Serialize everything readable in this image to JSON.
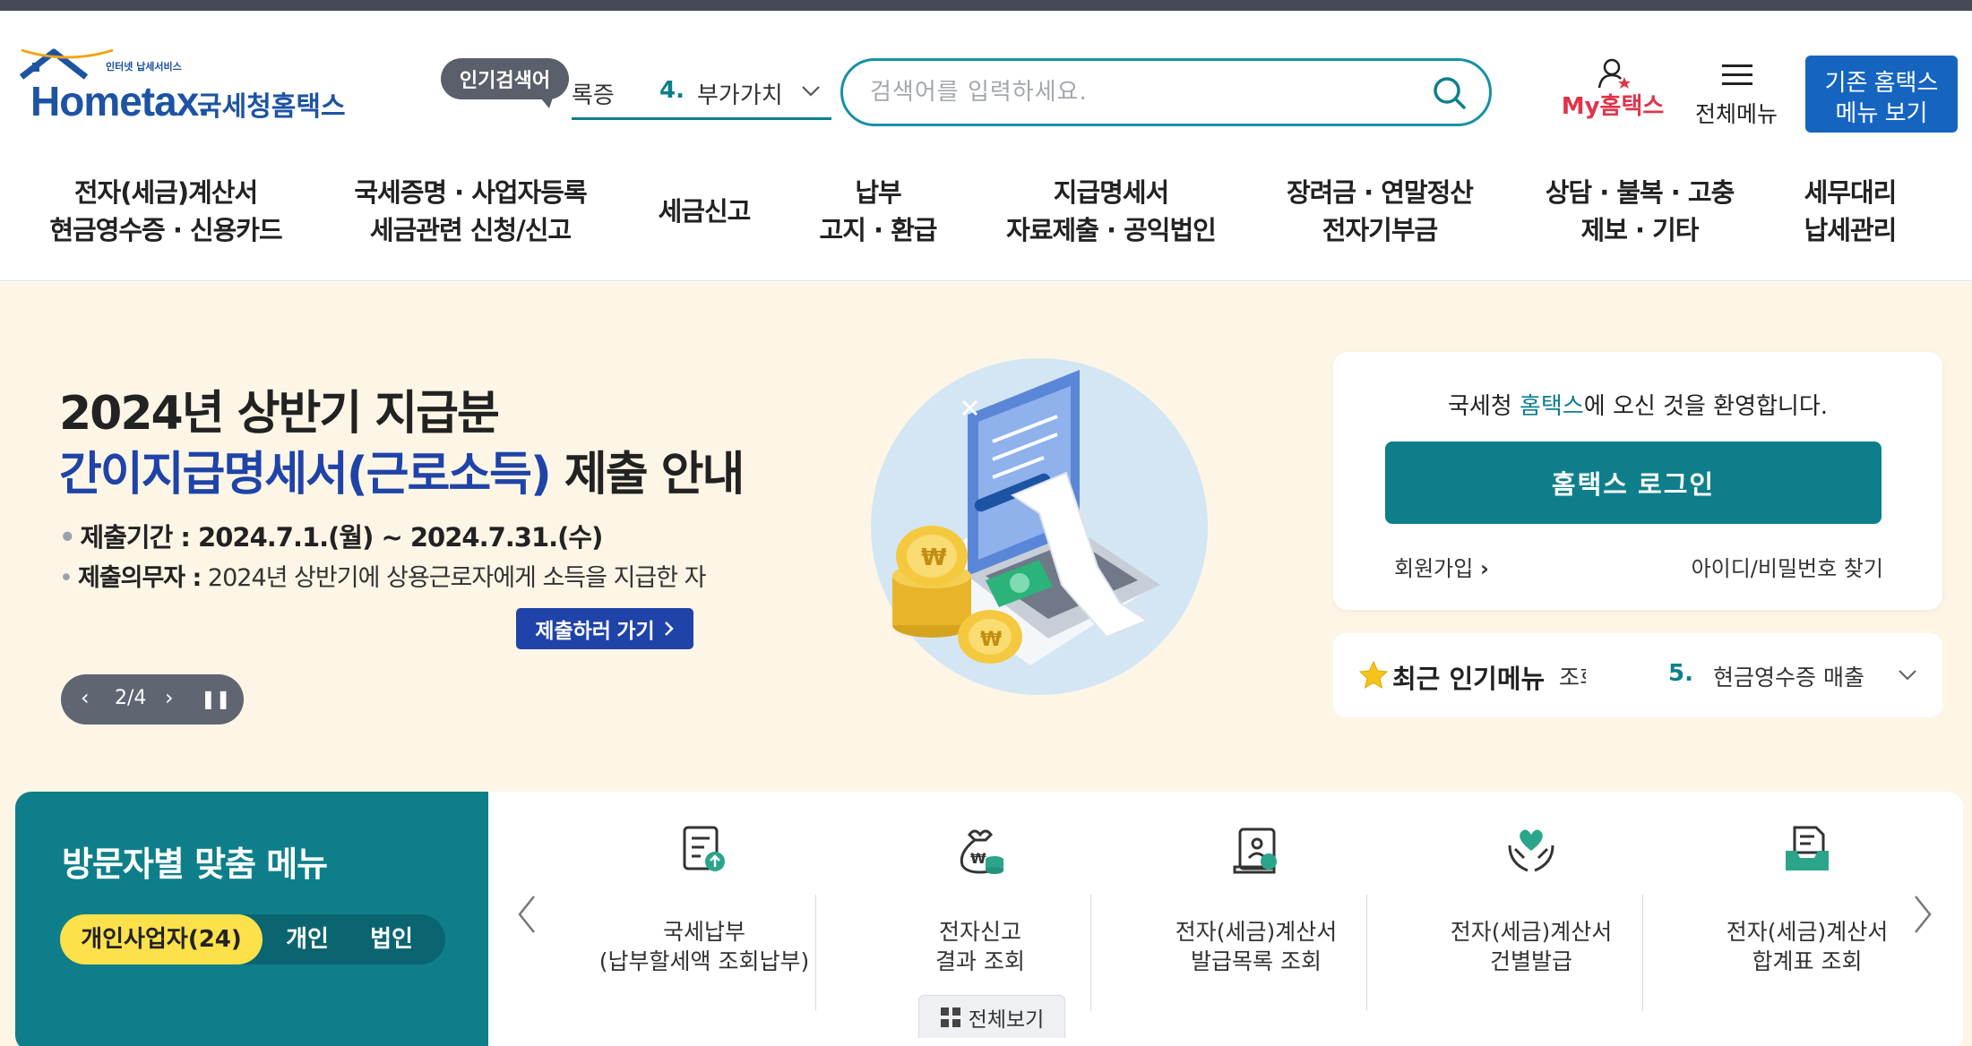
{
  "logo": {
    "sub": "인터넷 납세서비스",
    "main": "Hometax.",
    "kr": "국세청홈택스"
  },
  "search": {
    "popular_tag": "인기검색어",
    "rank_prev": "록증",
    "rank_num": "4.",
    "rank_text": "부가가치",
    "placeholder": "검색어를 입력하세요."
  },
  "header_actions": {
    "my_hometax": "My홈택스",
    "all_menu": "전체메뉴",
    "classic_line1": "기존 홈택스",
    "classic_line2": "메뉴 보기"
  },
  "gnb": [
    {
      "line1": "전자(세금)계산서",
      "line2": "현금영수증 · 신용카드"
    },
    {
      "line1": "국세증명 · 사업자등록",
      "line2": "세금관련 신청/신고"
    },
    {
      "line1": "세금신고",
      "line2": ""
    },
    {
      "line1": "납부",
      "line2": "고지 · 환급"
    },
    {
      "line1": "지급명세서",
      "line2": "자료제출 · 공익법인"
    },
    {
      "line1": "장려금 · 연말정산",
      "line2": "전자기부금"
    },
    {
      "line1": "상담 · 불복 · 고충",
      "line2": "제보 · 기타"
    },
    {
      "line1": "세무대리",
      "line2": "납세관리"
    }
  ],
  "hero": {
    "title1": "2024년 상반기 지급분",
    "title2_blue": "간이지급명세서(근로소득)",
    "title2_rest": " 제출 안내",
    "bullet1": "제출기간 : 2024.7.1.(월) ~ 2024.7.31.(수)",
    "bullet2_label": "제출의무자 :",
    "bullet2_text": " 2024년 상반기에 상용근로자에게 소득을 지급한 자",
    "cta": "제출하러 가기",
    "slide_indicator": "2/4"
  },
  "login": {
    "welcome_pre": "국세청 ",
    "welcome_hl": "홈택스",
    "welcome_post": "에 오신 것을 환영합니다.",
    "button": "홈택스 로그인",
    "signup": "회원가입",
    "find": "아이디/비밀번호 찾기"
  },
  "popular_menu": {
    "title": "최근 인기메뉴",
    "prev": "조회",
    "num": "5.",
    "text": "현금영수증 매출"
  },
  "visitor": {
    "title": "방문자별 맞춤 메뉴",
    "tabs": [
      "개인사업자(24)",
      "개인",
      "법인"
    ]
  },
  "quick_menu": [
    {
      "icon": "tax-payment-icon",
      "line1": "국세납부",
      "line2": "(납부할세액 조회납부)"
    },
    {
      "icon": "money-bag-icon",
      "line1": "전자신고",
      "line2": "결과 조회"
    },
    {
      "icon": "invoice-list-icon",
      "line1": "전자(세금)계산서",
      "line2": "발급목록 조회"
    },
    {
      "icon": "heart-hands-icon",
      "line1": "전자(세금)계산서",
      "line2": "건별발급"
    },
    {
      "icon": "document-tray-icon",
      "line1": "전자(세금)계산서",
      "line2": "합계표 조회"
    }
  ],
  "view_all": "전체보기",
  "colors": {
    "teal": "#0e7f8a",
    "brand_blue": "#1d53a3",
    "hero_bg": "#fdf6e6",
    "accent_yellow": "#fde14a",
    "my_red": "#e0344a"
  }
}
